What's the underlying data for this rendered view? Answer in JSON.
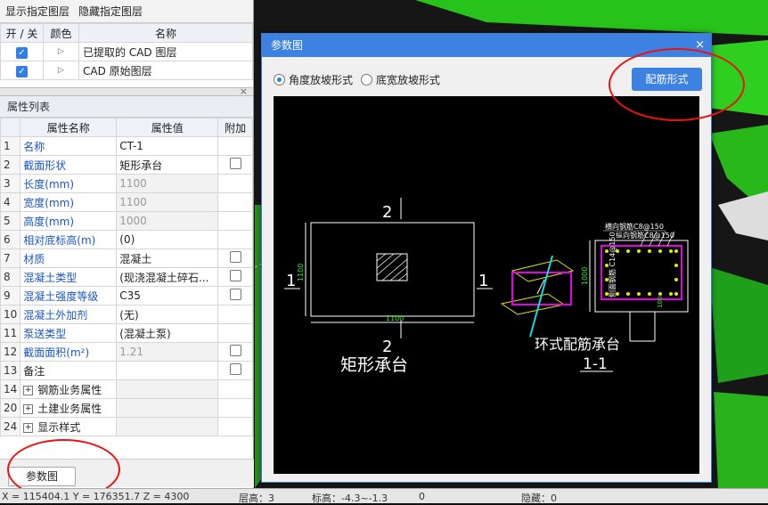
{
  "layer_panel": {
    "show_btn": "显示指定图层",
    "hide_btn": "隐藏指定图层",
    "headers": [
      "开 / 关",
      "颜色",
      "名称"
    ],
    "rows": [
      {
        "name": "已提取的 CAD 图层",
        "on": true
      },
      {
        "name": "CAD 原始图层",
        "on": true
      }
    ]
  },
  "props_panel": {
    "title": "属性列表",
    "headers": [
      "属性名称",
      "属性值",
      "附加"
    ],
    "rows": [
      {
        "n": "1",
        "k": "名称",
        "v": "CT-1",
        "grey": false,
        "check": false
      },
      {
        "n": "2",
        "k": "截面形状",
        "v": "矩形承台",
        "grey": false,
        "check": true
      },
      {
        "n": "3",
        "k": "长度(mm)",
        "v": "1100",
        "grey": true,
        "check": false
      },
      {
        "n": "4",
        "k": "宽度(mm)",
        "v": "1100",
        "grey": true,
        "check": false
      },
      {
        "n": "5",
        "k": "高度(mm)",
        "v": "1000",
        "grey": true,
        "check": false
      },
      {
        "n": "6",
        "k": "相对底标高(m)",
        "v": "(0)",
        "grey": false,
        "check": false
      },
      {
        "n": "7",
        "k": "材质",
        "v": "混凝土",
        "grey": false,
        "check": true
      },
      {
        "n": "8",
        "k": "混凝土类型",
        "v": "(现浇混凝土碎石...",
        "grey": false,
        "check": true
      },
      {
        "n": "9",
        "k": "混凝土强度等级",
        "v": "C35",
        "grey": false,
        "check": true
      },
      {
        "n": "10",
        "k": "混凝土外加剂",
        "v": "(无)",
        "grey": false,
        "check": false
      },
      {
        "n": "11",
        "k": "泵送类型",
        "v": "(混凝土泵)",
        "grey": false,
        "check": false
      },
      {
        "n": "12",
        "k": "截面面积(m²)",
        "v": "1.21",
        "grey": true,
        "check": true
      },
      {
        "n": "13",
        "k": "备注",
        "v": "",
        "grey": false,
        "check": true,
        "plain": true
      }
    ],
    "groups": [
      {
        "n": "14",
        "label": "钢筋业务属性"
      },
      {
        "n": "20",
        "label": "土建业务属性"
      },
      {
        "n": "24",
        "label": "显示样式"
      }
    ],
    "param_button": "参数图"
  },
  "dialog": {
    "title": "参数图",
    "close": "×",
    "radio1": "角度放坡形式",
    "radio2": "底宽放坡形式",
    "config_button": "配筋形式",
    "cad": {
      "label_2": "2",
      "label_1": "1",
      "dim_1100": "1100",
      "dim_1000": "1000",
      "rect_title": "矩形承台",
      "ring_title": "环式配筋承台",
      "section": "1-1",
      "rebar1": "横向钢筋C8@150",
      "rebar2": "纵向钢筋C8@150",
      "side_rebar": "侧面钢筋 C14@150"
    }
  },
  "status": {
    "coords": "X = 115404.1  Y = 176351.7  Z = 4300",
    "floor": "层高：3",
    "elev": "标高：-4.3~-1.3",
    "zero": "0",
    "hidden": "隐藏：0"
  },
  "colors": {
    "accent": "#3d82e0",
    "link": "#1a56c4",
    "annotation": "#e11111"
  }
}
